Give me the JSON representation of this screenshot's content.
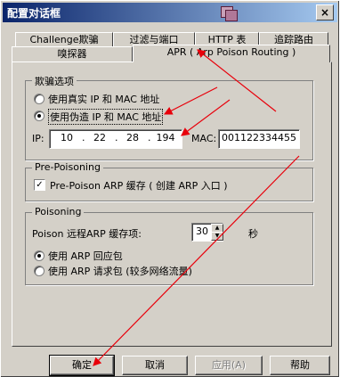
{
  "window": {
    "title": "配置对话框",
    "close_glyph": "×"
  },
  "tabs": [
    {
      "label": "Challenge欺骗"
    },
    {
      "label": "过滤与端口"
    },
    {
      "label": "HTTP 表"
    },
    {
      "label": "追踪路由"
    },
    {
      "label": "嗅探器"
    },
    {
      "label": "APR ( Arp Poison Routing )"
    }
  ],
  "spoof_group": {
    "title": "欺骗选项",
    "option_real": "使用真实 IP 和 MAC 地址",
    "option_fake": "使用伪造 IP 和 MAC 地址",
    "selected": "option_fake",
    "ip_label": "IP:",
    "ip": [
      "10",
      "22",
      "28",
      "194"
    ],
    "mac_label": "MAC:",
    "mac": "001122334455"
  },
  "pre_poisoning": {
    "title": "Pre-Poisoning",
    "checkbox_label": "Pre-Poison ARP 缓存 ( 创建 ARP 入口 )",
    "checked": true,
    "check_glyph": "✓"
  },
  "poisoning": {
    "title": "Poisoning",
    "cache_label": "Poison 远程ARP 缓存项:",
    "cache_value": "30",
    "unit": "秒",
    "option_reply": "使用 ARP 回应包",
    "option_request": "使用 ARP 请求包 (较多网络流量)",
    "selected": "option_reply"
  },
  "buttons": {
    "ok": "确定",
    "cancel": "取消",
    "apply": "应用(A)",
    "help": "帮助"
  },
  "annotation_color": "#e8000b"
}
